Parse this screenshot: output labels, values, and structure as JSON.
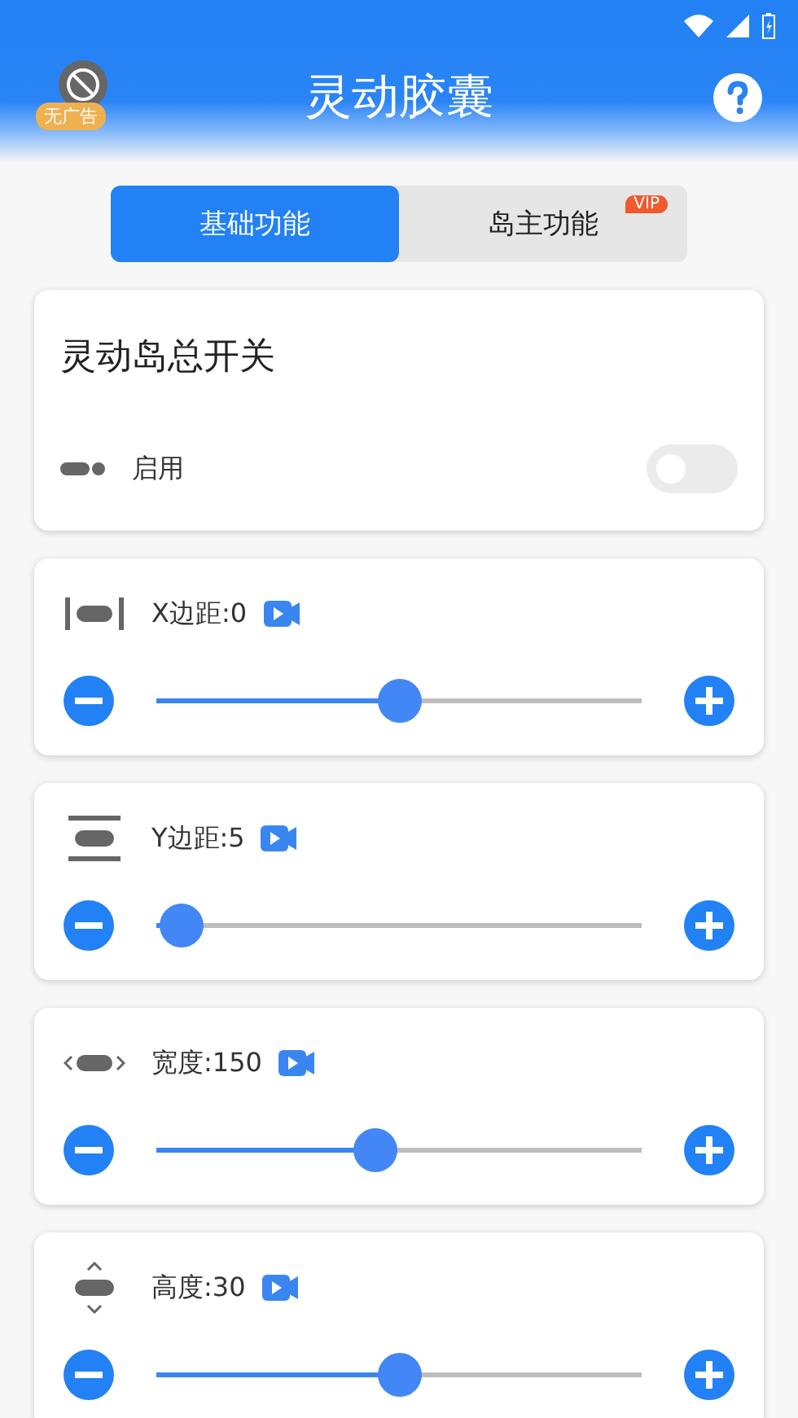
{
  "header": {
    "title": "灵动胶囊",
    "ad_badge": "无广告"
  },
  "tabs": [
    {
      "label": "基础功能",
      "selected": true
    },
    {
      "label": "岛主功能",
      "selected": false,
      "badge": "VIP"
    }
  ],
  "master_card": {
    "title": "灵动岛总开关",
    "row": {
      "label": "启用",
      "on": false
    }
  },
  "sliders": [
    {
      "kind": "horizontal",
      "label": "X边距:0",
      "level": 0.5
    },
    {
      "kind": "vertical",
      "label": "Y边距:5",
      "level": 0.05
    },
    {
      "kind": "width",
      "label": "宽度:150",
      "level": 0.45
    },
    {
      "kind": "height",
      "label": "高度:30",
      "level": 0.5
    }
  ]
}
